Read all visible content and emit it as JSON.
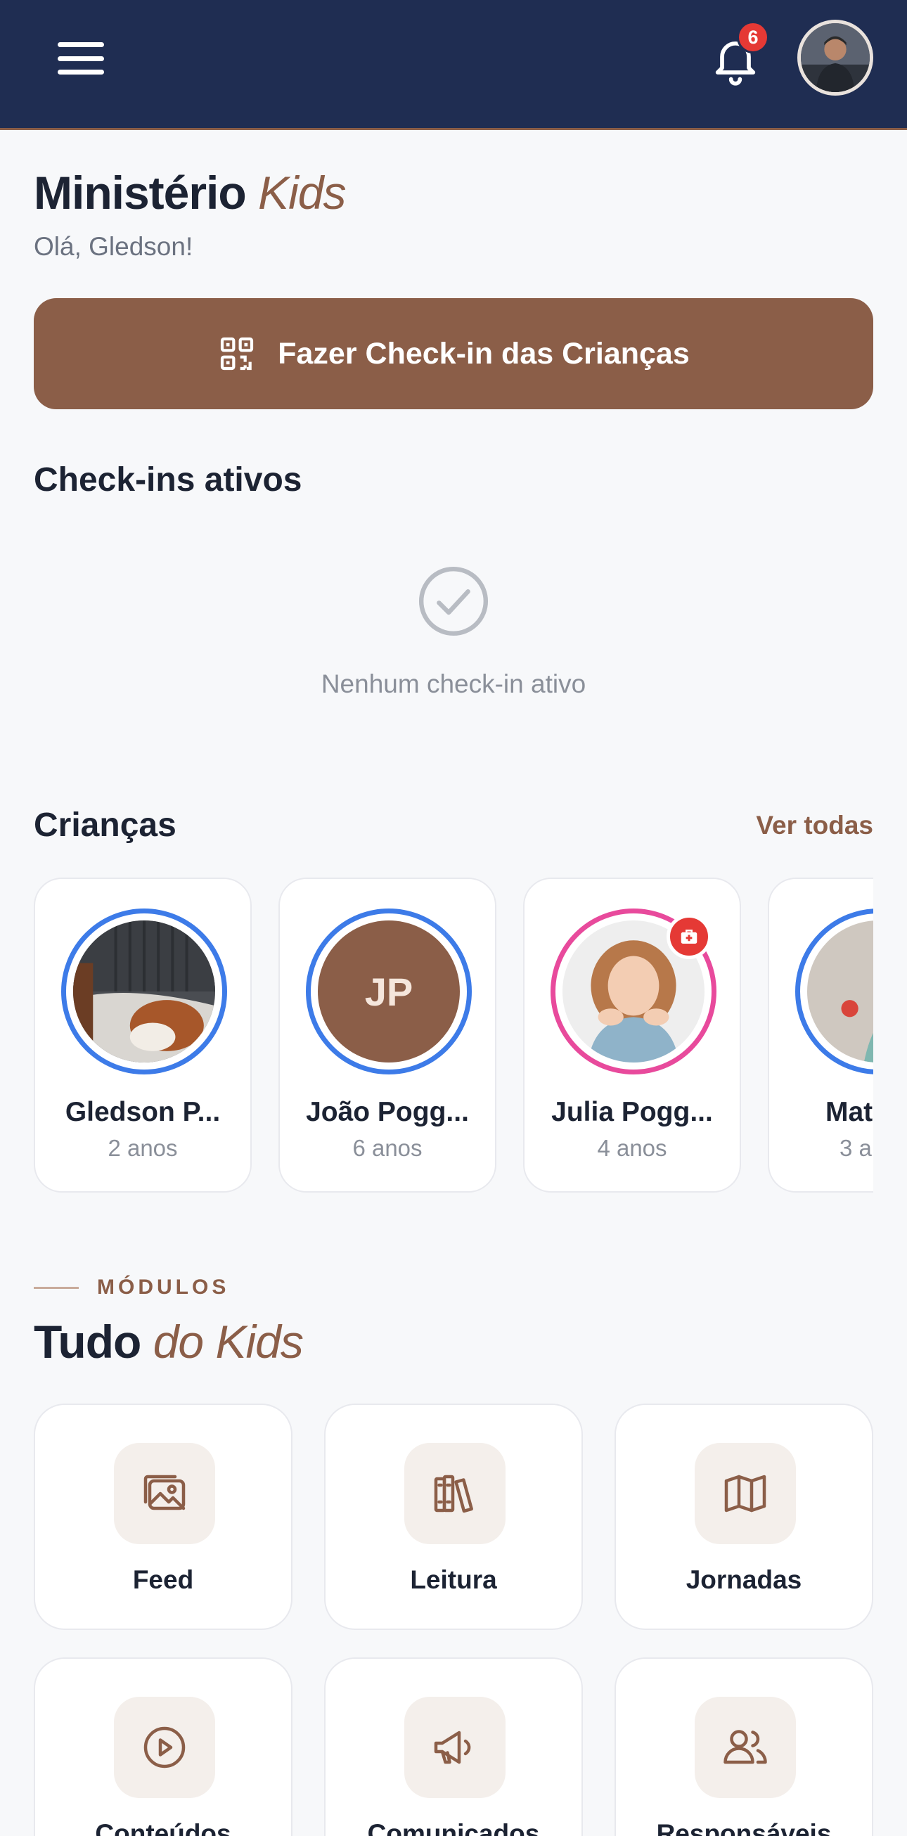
{
  "header": {
    "notification_count": "6",
    "menu_icon": "hamburger-menu-icon",
    "bell_icon": "bell-icon"
  },
  "page": {
    "title_main": "Ministério",
    "title_accent": "Kids",
    "greeting": "Olá, Gledson!",
    "checkin_button": "Fazer Check-in das Crianças"
  },
  "active_checkins": {
    "title": "Check-ins ativos",
    "empty_text": "Nenhum check-in ativo"
  },
  "children": {
    "title": "Crianças",
    "see_all": "Ver todas",
    "items": [
      {
        "name": "Gledson P...",
        "age": "2 anos",
        "ring": "blue"
      },
      {
        "name": "João Pogg...",
        "age": "6 anos",
        "initials": "JP",
        "ring": "blue"
      },
      {
        "name": "Julia Pogg...",
        "age": "4 anos",
        "ring": "pink",
        "medical_badge": true
      },
      {
        "name": "Mat",
        "age": "3 a",
        "ring": "blue"
      }
    ]
  },
  "modules": {
    "eyebrow": "MÓDULOS",
    "title_main": "Tudo",
    "title_accent": "do Kids",
    "items": [
      {
        "label": "Feed",
        "icon": "image-icon"
      },
      {
        "label": "Leitura",
        "icon": "books-icon"
      },
      {
        "label": "Jornadas",
        "icon": "map-icon"
      },
      {
        "label": "Conteúdos",
        "icon": "play-icon"
      },
      {
        "label": "Comunicados",
        "icon": "megaphone-icon"
      },
      {
        "label": "Responsáveis",
        "icon": "users-icon"
      }
    ]
  },
  "colors": {
    "navy": "#1f2d52",
    "accent": "#8b5e48",
    "ring_blue": "#3d7be8",
    "ring_pink": "#e84a9c",
    "badge_red": "#e53935"
  }
}
